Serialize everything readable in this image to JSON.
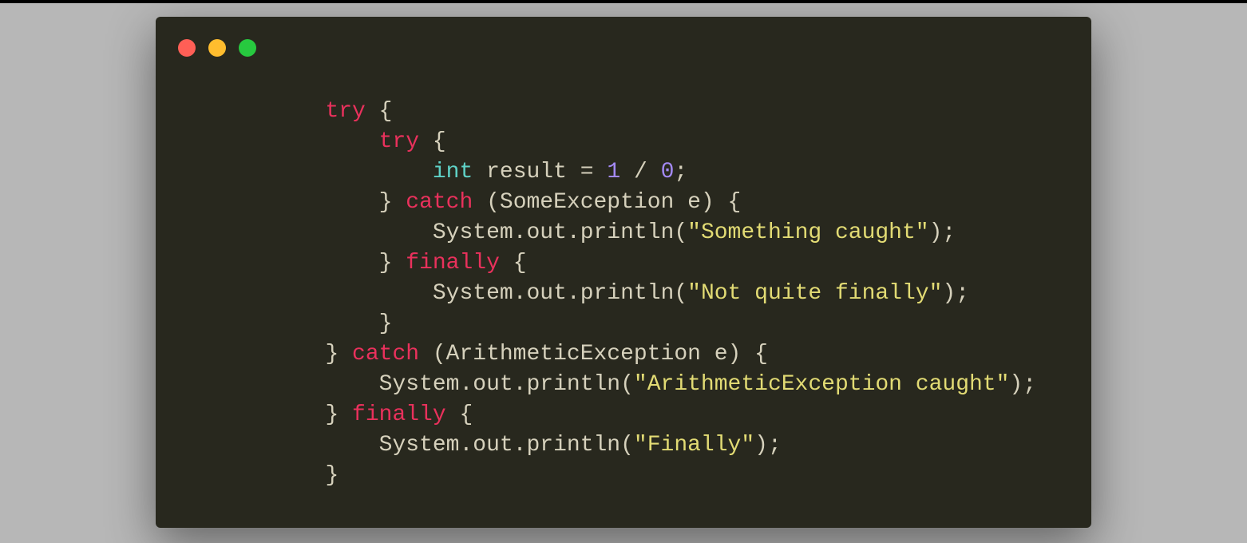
{
  "traffic": {
    "red": "red",
    "yellow": "yellow",
    "green": "green"
  },
  "indent": "    ",
  "code": {
    "l1": {
      "kw": "try",
      "brace": " {"
    },
    "l2": {
      "kw": "try",
      "brace": " {"
    },
    "l3": {
      "type": "int",
      "rest": " result = ",
      "n1": "1",
      "op": " / ",
      "n2": "0",
      "semi": ";"
    },
    "l4": {
      "close": "} ",
      "kw": "catch",
      "args": " (SomeException e) {"
    },
    "l5": {
      "call": "System.out.println(",
      "str": "\"Something caught\"",
      "end": ");"
    },
    "l6": {
      "close": "} ",
      "kw": "finally",
      "brace": " {"
    },
    "l7": {
      "call": "System.out.println(",
      "str": "\"Not quite finally\"",
      "end": ");"
    },
    "l8": {
      "close": "}"
    },
    "l9": {
      "close": "} ",
      "kw": "catch",
      "args": " (ArithmeticException e) {"
    },
    "l10": {
      "call": "System.out.println(",
      "str": "\"ArithmeticException caught\"",
      "end": ");"
    },
    "l11": {
      "close": "} ",
      "kw": "finally",
      "brace": " {"
    },
    "l12": {
      "call": "System.out.println(",
      "str": "\"Finally\"",
      "end": ");"
    },
    "l13": {
      "close": "}"
    }
  }
}
